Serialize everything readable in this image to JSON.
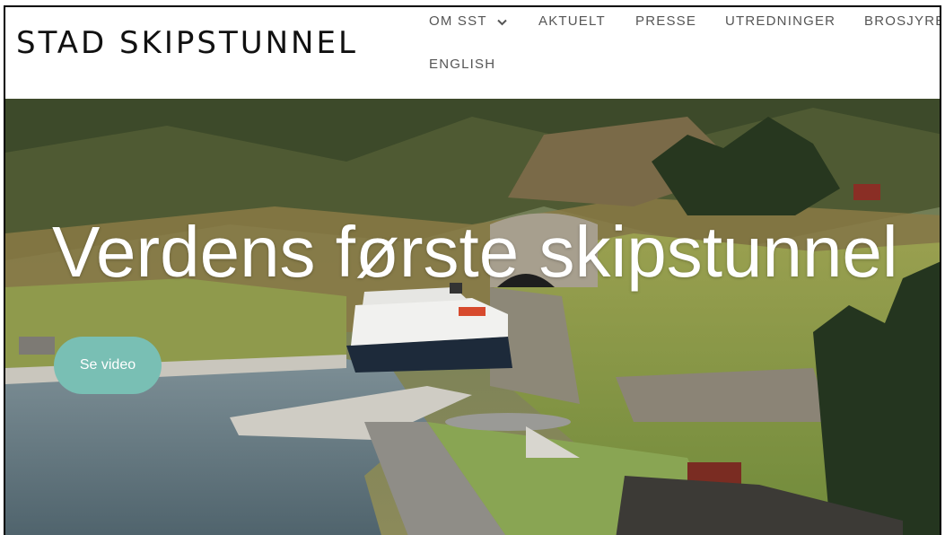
{
  "header": {
    "logo_text": "STAD SKIPSTUNNEL",
    "nav": {
      "om_sst": "OM SST",
      "aktuelt": "AKTUELT",
      "presse": "PRESSE",
      "utredninger": "UTREDNINGER",
      "brosjyre": "BROSJYRE",
      "english": "ENGLISH"
    }
  },
  "hero": {
    "title": "Verdens første skipstunnel",
    "video_button": "Se video",
    "image_icon": "hero-landscape-image"
  },
  "colors": {
    "accent_button": "#79bfb4",
    "nav_text": "#555555",
    "logo_text": "#111111",
    "hero_text": "#ffffff"
  }
}
